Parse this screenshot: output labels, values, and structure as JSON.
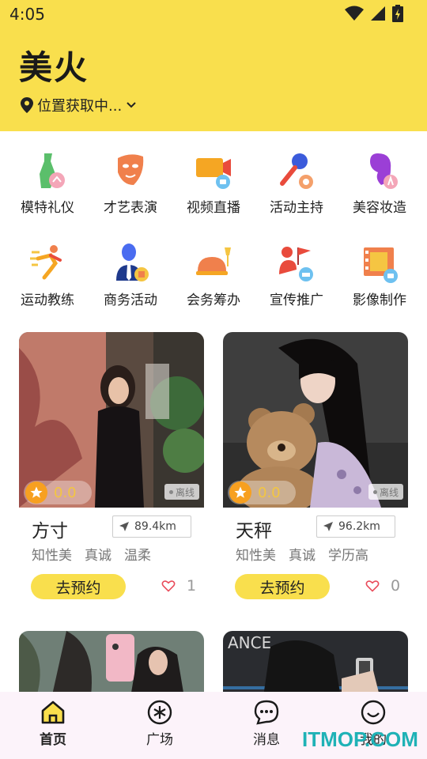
{
  "status_bar": {
    "time": "4:05"
  },
  "header": {
    "title": "美火",
    "location": "位置获取中..."
  },
  "categories": [
    {
      "label": "模特礼仪",
      "icon": "model-etiquette-icon"
    },
    {
      "label": "才艺表演",
      "icon": "talent-mask-icon"
    },
    {
      "label": "视频直播",
      "icon": "video-live-icon"
    },
    {
      "label": "活动主持",
      "icon": "host-microphone-icon"
    },
    {
      "label": "美容妆造",
      "icon": "beauty-makeup-icon"
    },
    {
      "label": "运动教练",
      "icon": "sports-coach-icon"
    },
    {
      "label": "商务活动",
      "icon": "business-person-icon"
    },
    {
      "label": "会务筹办",
      "icon": "catering-dish-icon"
    },
    {
      "label": "宣传推广",
      "icon": "promotion-flag-icon"
    },
    {
      "label": "影像制作",
      "icon": "film-production-icon"
    }
  ],
  "cards": [
    {
      "rating": "0.0",
      "status": "离线",
      "name": "方寸",
      "distance": "89.4km",
      "tags": [
        "知性美",
        "真诚",
        "温柔"
      ],
      "book_label": "去预约",
      "likes": "1"
    },
    {
      "rating": "0.0",
      "status": "离线",
      "name": "天秤",
      "distance": "96.2km",
      "tags": [
        "知性美",
        "真诚",
        "学历高"
      ],
      "book_label": "去预约",
      "likes": "0"
    }
  ],
  "bottom_nav": [
    {
      "label": "首页",
      "icon": "home-icon",
      "active": true
    },
    {
      "label": "广场",
      "icon": "square-star-icon"
    },
    {
      "label": "消息",
      "icon": "message-icon"
    },
    {
      "label": "我的",
      "icon": "profile-smile-icon"
    }
  ],
  "watermark": "ITMOP.COM",
  "colors": {
    "accent": "#f9df4d",
    "star": "#f7a020",
    "nav_bg": "#fcf3fa",
    "watermark": "#1fb2b6"
  }
}
